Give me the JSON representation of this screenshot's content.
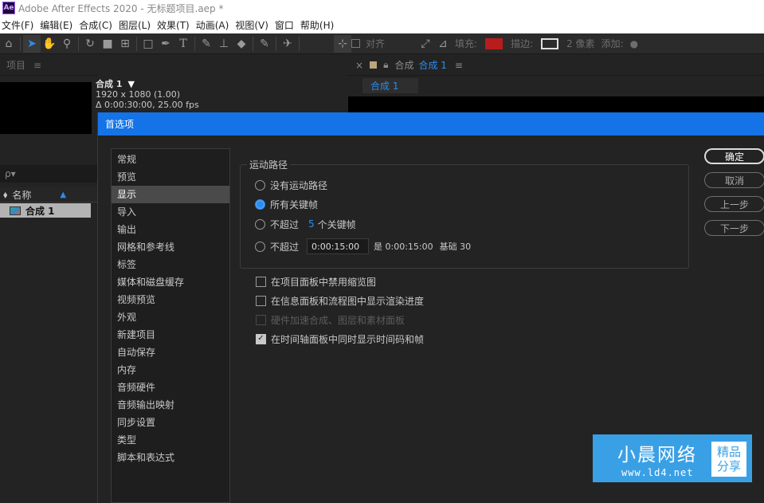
{
  "window": {
    "title": "Adobe After Effects 2020 - 无标题项目.aep *",
    "logo": "Ae"
  },
  "menu": [
    "文件(F)",
    "编辑(E)",
    "合成(C)",
    "图层(L)",
    "效果(T)",
    "动画(A)",
    "视图(V)",
    "窗口",
    "帮助(H)"
  ],
  "toolbar": {
    "tools": [
      "home-icon",
      "selection-arrow-icon",
      "hand-icon",
      "zoom-icon",
      "rotate-icon",
      "camera-icon",
      "pan-behind-icon",
      "rectangle-icon",
      "pen-icon",
      "text-icon",
      "brush-icon",
      "clone-stamp-icon",
      "eraser-icon",
      "roto-brush-icon",
      "puppet-pin-icon"
    ],
    "snap_label": "对齐",
    "fill_label": "填充:",
    "fill_color": "#b81c1c",
    "stroke_label": "描边:",
    "stroke_width": "2 像素",
    "add_label": "添加:"
  },
  "project_panel": {
    "title": "项目",
    "comp_name": "合成 1",
    "comp_res": "1920 x 1080 (1.00)",
    "comp_duration": "Δ 0:00:30:00, 25.00 fps",
    "search_icon": "ρ▾",
    "col_name": "名称",
    "row_name": "合成 1"
  },
  "comp_panel": {
    "tab_prefix": "合成",
    "tab_active": "合成 1",
    "subtab": "合成 1"
  },
  "dialog": {
    "title": "首选项",
    "categories": [
      "常规",
      "预览",
      "显示",
      "导入",
      "输出",
      "网格和参考线",
      "标签",
      "媒体和磁盘缓存",
      "视频预览",
      "外观",
      "新建项目",
      "自动保存",
      "内存",
      "音频硬件",
      "音频输出映射",
      "同步设置",
      "类型",
      "脚本和表达式"
    ],
    "selected_index": 2,
    "motion_path": {
      "label": "运动路径",
      "opt_none": "没有运动路径",
      "opt_all": "所有关键帧",
      "opt_max_prefix": "不超过",
      "opt_max_count": "5",
      "opt_max_suffix": "个关键帧",
      "opt_time_prefix": "不超过",
      "opt_time_value": "0:00:15:00",
      "opt_time_is": "是 0:00:15:00",
      "opt_time_base": "基础 30",
      "selected": "all"
    },
    "checks": {
      "disable_thumbnails": "在项目面板中禁用缩览图",
      "show_render_progress": "在信息面板和流程图中显示渲染进度",
      "hw_accel": "硬件加速合成、图层和素材面板",
      "show_timecode_frames": "在时间轴面板中同时显示时间码和帧"
    },
    "buttons": {
      "ok": "确定",
      "cancel": "取消",
      "prev": "上一步",
      "next": "下一步"
    }
  },
  "watermark": {
    "name": "小晨网络",
    "url": "www.ld4.net",
    "badge_top": "精品",
    "badge_bottom": "分享"
  }
}
